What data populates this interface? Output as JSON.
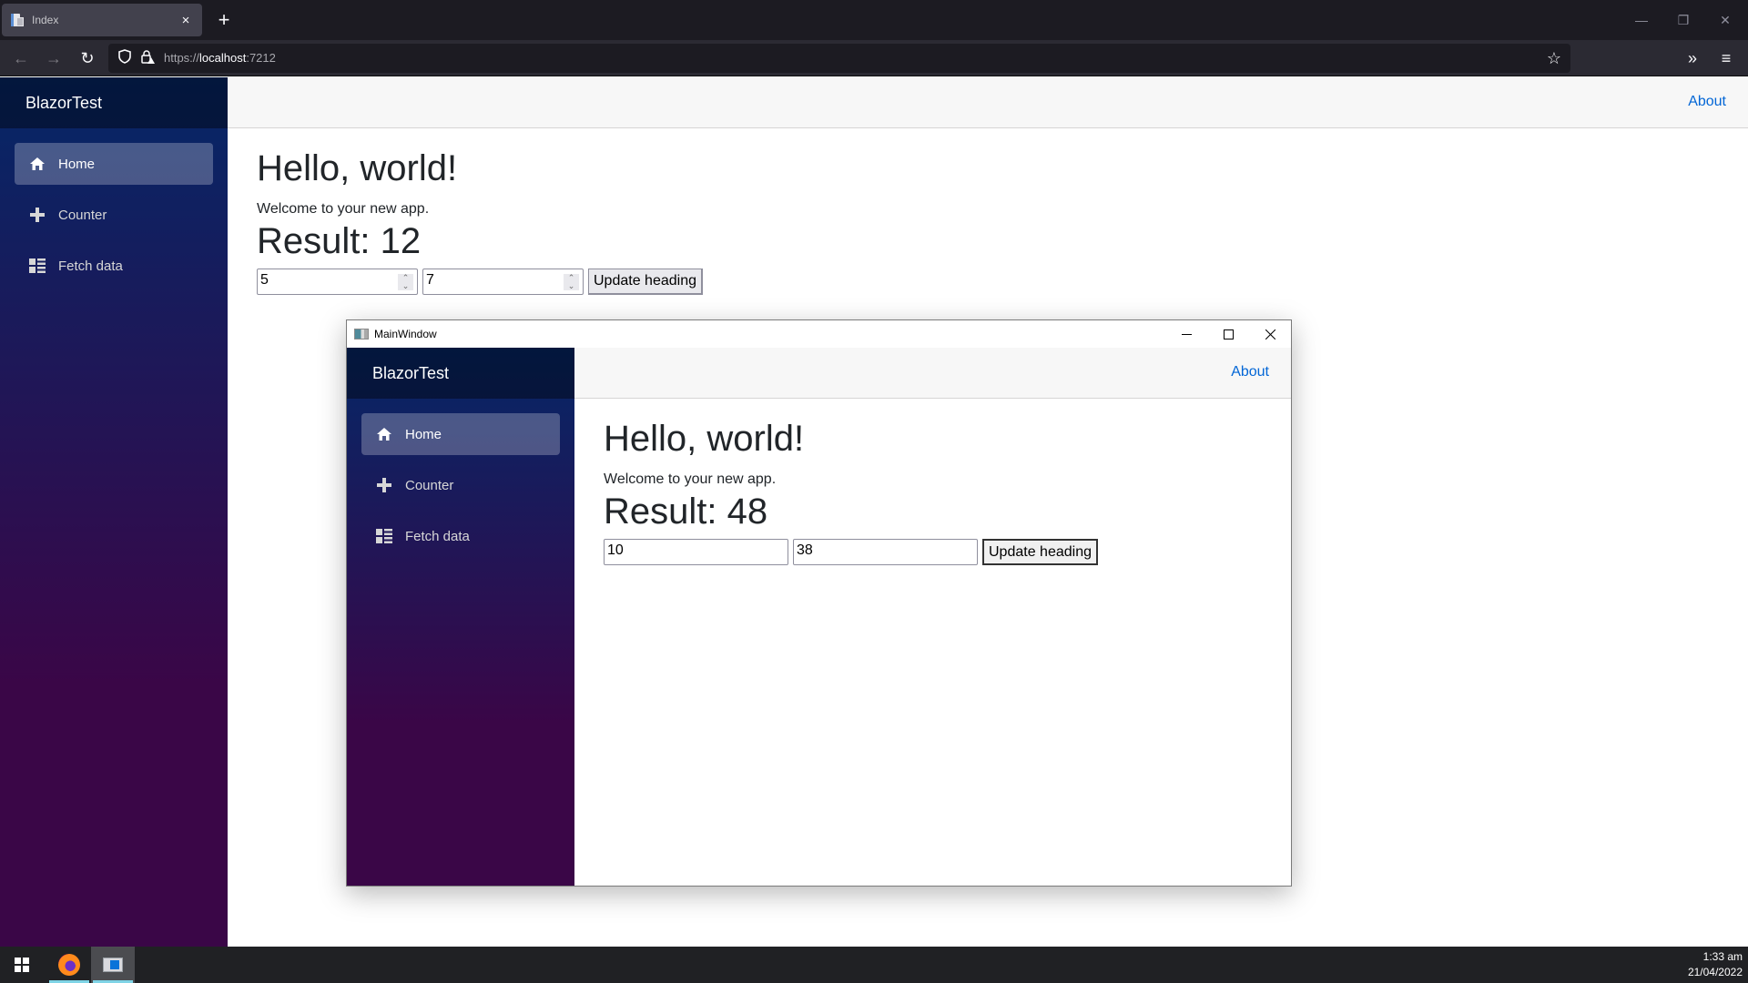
{
  "browser": {
    "tab": {
      "title": "Index",
      "favicon": "page-icon",
      "close_icon": "×"
    },
    "new_tab_icon": "+",
    "window_controls": {
      "minimize": "—",
      "restore": "❐",
      "close": "✕"
    },
    "nav": {
      "back_icon": "←",
      "forward_icon": "→",
      "reload_icon": "↻"
    },
    "url": {
      "scheme": "https://",
      "host": "localhost",
      "port": ":7212",
      "shield_icon": "⛉",
      "lock_icon": "🔒︎",
      "bookmark_icon": "☆"
    },
    "overflow_icon": "»",
    "menu_icon": "≡"
  },
  "browser_app": {
    "brand": "BlazorTest",
    "nav_items": [
      {
        "label": "Home",
        "icon": "home-icon",
        "active": true
      },
      {
        "label": "Counter",
        "icon": "plus-icon",
        "active": false
      },
      {
        "label": "Fetch data",
        "icon": "list-icon",
        "active": false
      }
    ],
    "about_link": "About",
    "heading": "Hello, world!",
    "welcome": "Welcome to your new app.",
    "result": "Result: 12",
    "input_a": "5",
    "input_b": "7",
    "update_button": "Update heading"
  },
  "main_window": {
    "title": "MainWindow",
    "controls": {
      "minimize": "—",
      "maximize": "☐",
      "close": "✕"
    },
    "app": {
      "brand": "BlazorTest",
      "nav_items": [
        {
          "label": "Home",
          "icon": "home-icon",
          "active": true
        },
        {
          "label": "Counter",
          "icon": "plus-icon",
          "active": false
        },
        {
          "label": "Fetch data",
          "icon": "list-icon",
          "active": false
        }
      ],
      "about_link": "About",
      "heading": "Hello, world!",
      "welcome": "Welcome to your new app.",
      "result": "Result: 48",
      "input_a": "10",
      "input_b": "38",
      "update_button": "Update heading"
    }
  },
  "taskbar": {
    "apps": [
      "Firefox",
      "MainWindow"
    ],
    "time": "1:33 am",
    "date": "21/04/2022"
  },
  "colors": {
    "sidebar_top": "#052767",
    "sidebar_bottom": "#3a0647",
    "link": "#0366d6",
    "text": "#212529"
  }
}
